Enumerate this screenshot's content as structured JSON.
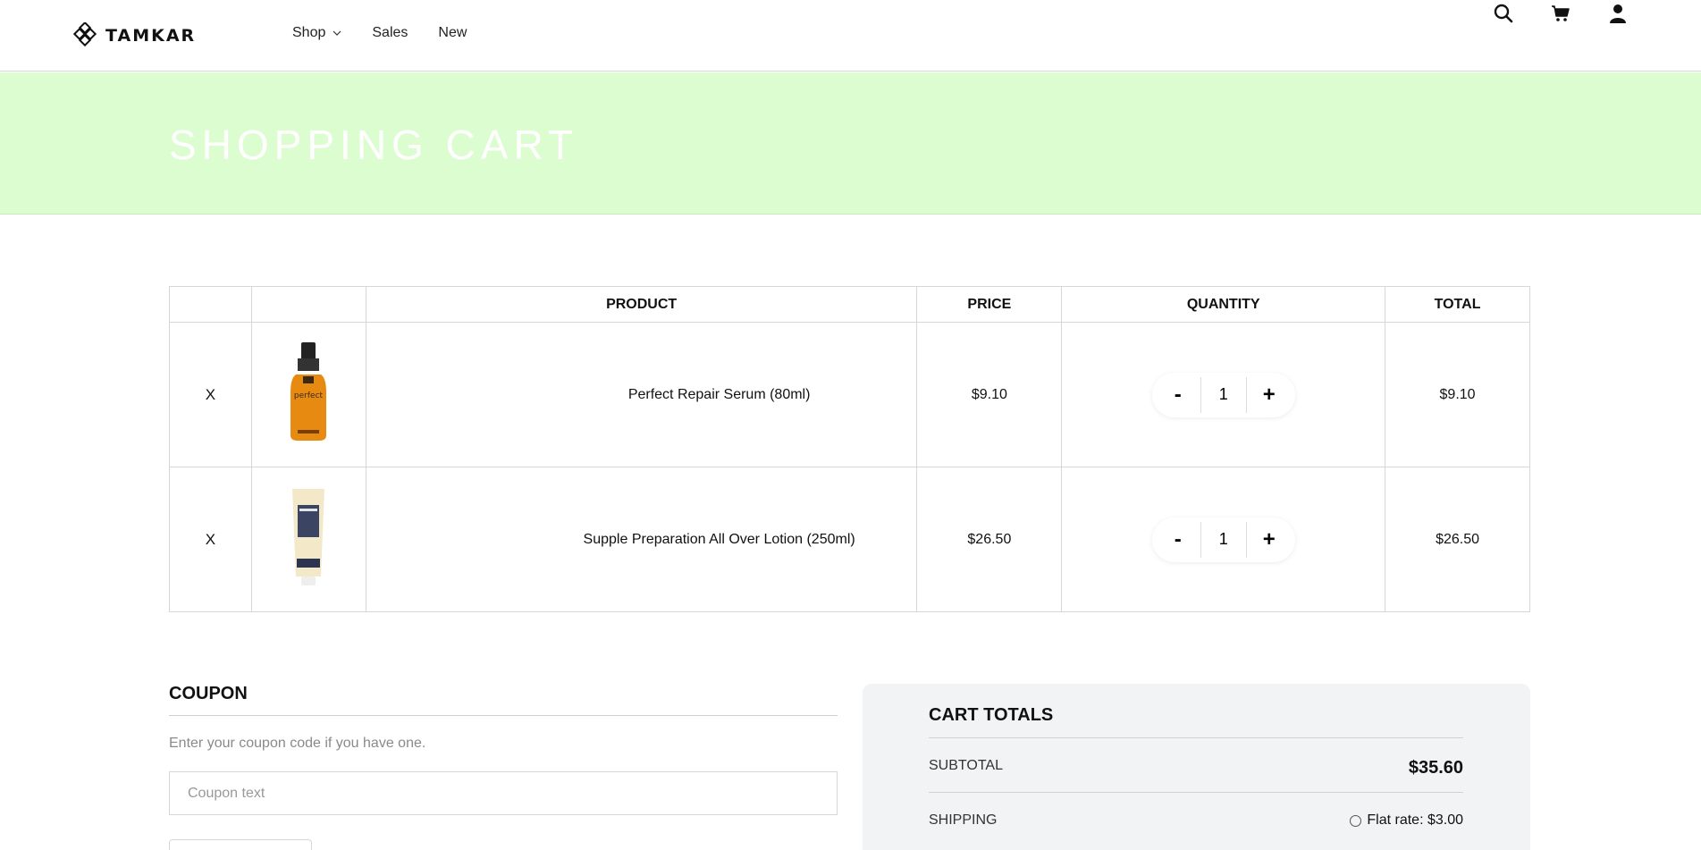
{
  "header": {
    "brand": "TAMKAR",
    "nav": [
      {
        "label": "Shop",
        "has_dropdown": true
      },
      {
        "label": "Sales"
      },
      {
        "label": "New"
      }
    ],
    "icons": [
      "search-icon",
      "cart-icon",
      "user-icon"
    ]
  },
  "banner": {
    "title": "SHOPPING CART",
    "background": "#dcfdd0"
  },
  "cart": {
    "columns": [
      "",
      "",
      "PRODUCT",
      "PRICE",
      "QUANTITY",
      "TOTAL"
    ],
    "items": [
      {
        "remove": "X",
        "name": "Perfect Repair Serum (80ml)",
        "price": "$9.10",
        "quantity": "1",
        "total": "$9.10",
        "image": "serum-bottle"
      },
      {
        "remove": "X",
        "name": "Supple Preparation All Over Lotion (250ml)",
        "price": "$26.50",
        "quantity": "1",
        "total": "$26.50",
        "image": "lotion-tube"
      }
    ],
    "minus_label": "-",
    "plus_label": "+"
  },
  "coupon": {
    "title": "COUPON",
    "description": "Enter your coupon code if you have one.",
    "placeholder": "Coupon text"
  },
  "totals": {
    "title": "CART TOTALS",
    "subtotal_label": "SUBTOTAL",
    "subtotal_value": "$35.60",
    "shipping_label": "SHIPPING",
    "shipping_option": "Flat rate: $3.00"
  }
}
